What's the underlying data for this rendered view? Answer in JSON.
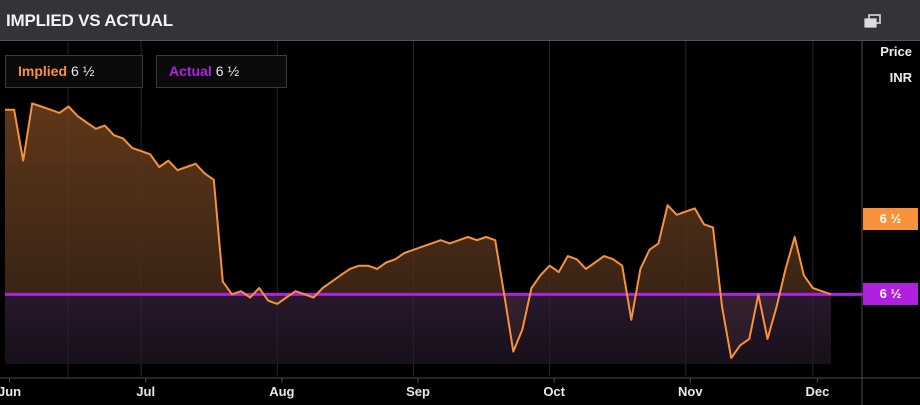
{
  "header": {
    "title": "IMPLIED VS ACTUAL"
  },
  "legend": {
    "implied_label": "Implied",
    "implied_value": "6 ½",
    "actual_label": "Actual",
    "actual_value": "6 ½"
  },
  "axis": {
    "right_title": "Price",
    "right_unit": "INR"
  },
  "tags": {
    "implied": "6 ½",
    "actual": "6 ½"
  },
  "colors": {
    "implied": "#f7923a",
    "actual": "#b020e0",
    "background": "#000000",
    "header": "#333338"
  },
  "chart_data": {
    "type": "line",
    "x_tick_labels": [
      "Jun",
      "Jul",
      "Aug",
      "Sep",
      "Oct",
      "Nov",
      "Dec"
    ],
    "x_tick_positions": [
      0.5,
      15.5,
      30.5,
      45.5,
      60.5,
      75.5,
      89.5
    ],
    "x": [
      0,
      1,
      2,
      3,
      4,
      5,
      6,
      7,
      8,
      9,
      10,
      11,
      12,
      13,
      14,
      15,
      16,
      17,
      18,
      19,
      20,
      21,
      22,
      23,
      24,
      25,
      26,
      27,
      28,
      29,
      30,
      31,
      32,
      33,
      34,
      35,
      36,
      37,
      38,
      39,
      40,
      41,
      42,
      43,
      44,
      45,
      46,
      47,
      48,
      49,
      50,
      51,
      52,
      53,
      54,
      55,
      56,
      57,
      58,
      59,
      60,
      61,
      62,
      63,
      64,
      65,
      66,
      67,
      68,
      69,
      70,
      71,
      72,
      73,
      74,
      75,
      76,
      77,
      78,
      79,
      80,
      81,
      82,
      83,
      84,
      85,
      86,
      87,
      88,
      89,
      90,
      91
    ],
    "series": [
      {
        "name": "Implied",
        "values": [
          9.4,
          9.4,
          8.6,
          9.5,
          9.45,
          9.4,
          9.35,
          9.45,
          9.3,
          9.2,
          9.1,
          9.15,
          9.0,
          8.95,
          8.8,
          8.75,
          8.7,
          8.5,
          8.6,
          8.45,
          8.5,
          8.55,
          8.4,
          8.3,
          6.7,
          6.5,
          6.55,
          6.45,
          6.6,
          6.4,
          6.35,
          6.45,
          6.55,
          6.5,
          6.45,
          6.6,
          6.7,
          6.8,
          6.9,
          6.95,
          6.95,
          6.9,
          7.0,
          7.05,
          7.15,
          7.2,
          7.25,
          7.3,
          7.35,
          7.3,
          7.35,
          7.4,
          7.35,
          7.4,
          7.35,
          6.5,
          5.6,
          5.95,
          6.6,
          6.8,
          6.95,
          6.85,
          7.1,
          7.05,
          6.9,
          7.0,
          7.1,
          7.05,
          6.95,
          6.1,
          6.9,
          7.2,
          7.3,
          7.9,
          7.75,
          7.8,
          7.85,
          7.6,
          7.55,
          6.3,
          5.5,
          5.7,
          5.8,
          6.5,
          5.8,
          6.3,
          6.9,
          7.4,
          6.8,
          6.6,
          6.55,
          6.5
        ]
      },
      {
        "name": "Actual",
        "values": [
          6.5,
          6.5,
          6.5,
          6.5,
          6.5,
          6.5,
          6.5,
          6.5,
          6.5,
          6.5,
          6.5,
          6.5,
          6.5,
          6.5,
          6.5,
          6.5,
          6.5,
          6.5,
          6.5,
          6.5,
          6.5,
          6.5,
          6.5,
          6.5,
          6.5,
          6.5,
          6.5,
          6.5,
          6.5,
          6.5,
          6.5,
          6.5,
          6.5,
          6.5,
          6.5,
          6.5,
          6.5,
          6.5,
          6.5,
          6.5,
          6.5,
          6.5,
          6.5,
          6.5,
          6.5,
          6.5,
          6.5,
          6.5,
          6.5,
          6.5,
          6.5,
          6.5,
          6.5,
          6.5,
          6.5,
          6.5,
          6.5,
          6.5,
          6.5,
          6.5,
          6.5,
          6.5,
          6.5,
          6.5,
          6.5,
          6.5,
          6.5,
          6.5,
          6.5,
          6.5,
          6.5,
          6.5,
          6.5,
          6.5,
          6.5,
          6.5,
          6.5,
          6.5,
          6.5,
          6.5,
          6.5,
          6.5,
          6.5,
          6.5,
          6.5,
          6.5,
          6.5,
          6.5,
          6.5,
          6.5,
          6.5,
          6.5
        ]
      }
    ],
    "ylim": [
      5.5,
      9.6
    ],
    "grid": true,
    "legend_position": "top-left"
  }
}
